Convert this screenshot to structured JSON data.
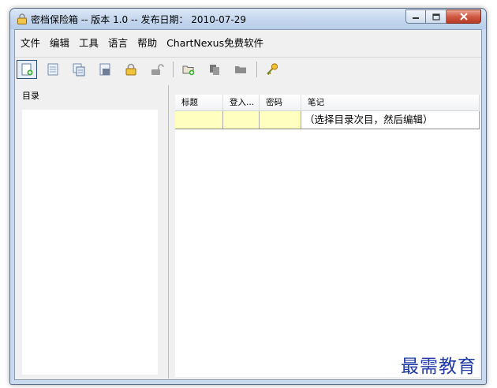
{
  "window": {
    "title": "密档保险箱 -- 版本 1.0 -- 发布日期： 2010-07-29",
    "controls": [
      "minimize",
      "maximize",
      "close"
    ]
  },
  "menu": [
    "文件",
    "编辑",
    "工具",
    "语言",
    "帮助",
    "ChartNexus免费软件"
  ],
  "toolbar": [
    {
      "icon": "new-entry-icon",
      "active": true
    },
    {
      "icon": "document-icon"
    },
    {
      "icon": "copy-document-icon"
    },
    {
      "icon": "paste-document-icon"
    },
    {
      "icon": "lock-icon"
    },
    {
      "icon": "unlock-icon"
    },
    {
      "icon": "new-folder-icon"
    },
    {
      "icon": "copy-icon"
    },
    {
      "icon": "folder-icon"
    },
    {
      "icon": "key-icon"
    }
  ],
  "left_panel": {
    "label": "目录"
  },
  "grid": {
    "columns": [
      "标题",
      "登入...",
      "密码",
      "笔记"
    ],
    "rows": [
      {
        "title": "",
        "login": "",
        "password": "",
        "note": "（选择目录次目，然后编辑）"
      }
    ]
  },
  "watermark": "最需教育"
}
